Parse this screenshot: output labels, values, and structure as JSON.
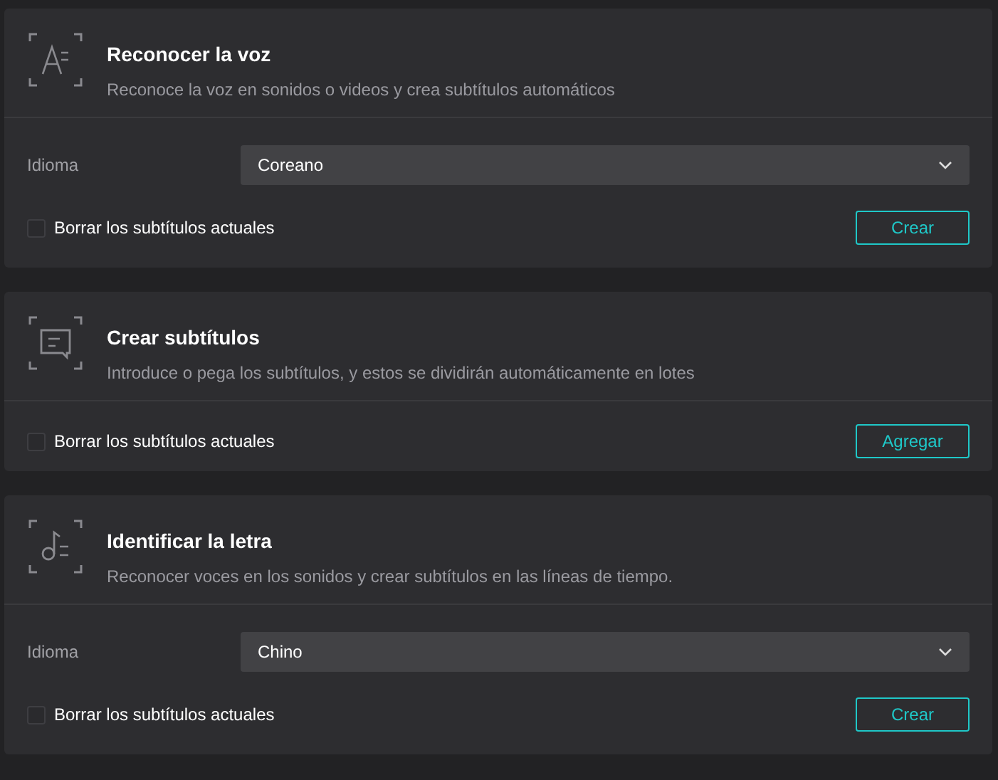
{
  "panels": [
    {
      "kind": "recognize",
      "title": "Reconocer la voz",
      "description": "Reconoce la voz en sonidos o videos y crea subtítulos automáticos",
      "language": {
        "label": "Idioma",
        "value": "Coreano"
      },
      "checkbox": {
        "label": "Borrar los subtítulos actuales",
        "checked": false
      },
      "button": "Crear"
    },
    {
      "kind": "create",
      "title": "Crear subtítulos",
      "description": "Introduce o pega los subtítulos, y estos se dividirán automáticamente en lotes",
      "checkbox": {
        "label": "Borrar los subtítulos actuales",
        "checked": false
      },
      "button": "Agregar"
    },
    {
      "kind": "lyrics",
      "title": "Identificar la letra",
      "description": "Reconocer voces en los sonidos y crear subtítulos en las líneas de tiempo.",
      "language": {
        "label": "Idioma",
        "value": "Chino"
      },
      "checkbox": {
        "label": "Borrar los subtítulos actuales",
        "checked": false
      },
      "button": "Crear"
    }
  ]
}
